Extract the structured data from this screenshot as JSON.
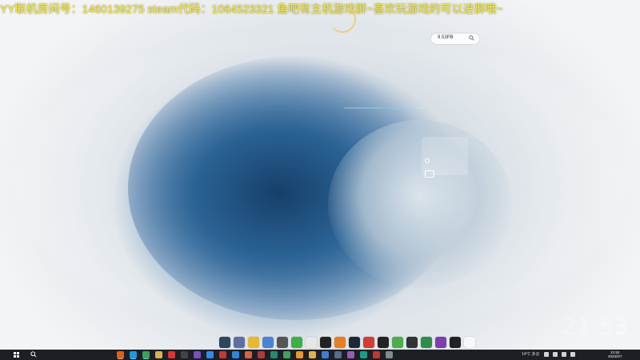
{
  "overlay": {
    "banner": "YY联机房间号：1460139275  steam代码：1064523321 鱼吧有主机游戏群~喜欢玩游戏的可以进群哦~"
  },
  "search_widget": {
    "text": "9.53PB",
    "icon": "search-icon"
  },
  "desktop_widget": {
    "line1": "———"
  },
  "clock": {
    "big_time": "21:53",
    "taskbar_time": "21:53",
    "taskbar_date": "2023/2/7"
  },
  "taskbar": {
    "weather_text": "14°C 多云"
  },
  "dock": {
    "items": [
      {
        "name": "steam-icon",
        "color": "#2a475e"
      },
      {
        "name": "uplay-icon",
        "color": "#5d6fa3"
      },
      {
        "name": "emoji-game-icon",
        "color": "#e9b82d"
      },
      {
        "name": "discord-icon",
        "color": "#4b82d6"
      },
      {
        "name": "gear-bar-icon",
        "color": "#555555"
      },
      {
        "name": "wechat-icon",
        "color": "#3cb043"
      },
      {
        "name": "clock-icon",
        "color": "#e7e7e7"
      },
      {
        "name": "epic-icon",
        "color": "#222222"
      },
      {
        "name": "ubisoft-icon",
        "color": "#e67e22"
      },
      {
        "name": "steam-blue-icon",
        "color": "#1b2838"
      },
      {
        "name": "netease-icon",
        "color": "#d43c33"
      },
      {
        "name": "ea-icon",
        "color": "#222222"
      },
      {
        "name": "green-app-icon",
        "color": "#4cae4c"
      },
      {
        "name": "obs-icon",
        "color": "#333333"
      },
      {
        "name": "play-store-icon",
        "color": "#2d8f47"
      },
      {
        "name": "gog-icon",
        "color": "#7b3fb0"
      },
      {
        "name": "xbox-icon",
        "color": "#222222"
      },
      {
        "name": "qq-icon",
        "color": "#f8f8f8"
      }
    ]
  },
  "taskbar_apps": [
    {
      "name": "firefox-icon",
      "color": "#e66000"
    },
    {
      "name": "edge-icon",
      "color": "#1a9ae0"
    },
    {
      "name": "chrome-icon",
      "color": "#34a853"
    },
    {
      "name": "files-icon",
      "color": "#d9b24c"
    },
    {
      "name": "record-icon",
      "color": "#d33"
    },
    {
      "name": "terminal-icon",
      "color": "#444"
    },
    {
      "name": "game-icon",
      "color": "#7a4fbf"
    },
    {
      "name": "mail-icon",
      "color": "#2d8cf0"
    },
    {
      "name": "app-icon",
      "color": "#c33"
    },
    {
      "name": "photo-icon",
      "color": "#2e86de"
    },
    {
      "name": "music-icon",
      "color": "#e15f41"
    },
    {
      "name": "video-icon",
      "color": "#b33939"
    },
    {
      "name": "shop-icon",
      "color": "#218c74"
    },
    {
      "name": "chat-icon",
      "color": "#3ba55d"
    },
    {
      "name": "browser-icon",
      "color": "#f0932b"
    },
    {
      "name": "folder-icon",
      "color": "#e3b341"
    },
    {
      "name": "code-icon",
      "color": "#3c7fd6"
    },
    {
      "name": "steam-tb-icon",
      "color": "#5a6b8c"
    },
    {
      "name": "misc-icon",
      "color": "#9b59b6"
    },
    {
      "name": "misc2-icon",
      "color": "#16a085"
    },
    {
      "name": "misc3-icon",
      "color": "#c0392b"
    },
    {
      "name": "misc4-icon",
      "color": "#7f8c8d"
    }
  ]
}
